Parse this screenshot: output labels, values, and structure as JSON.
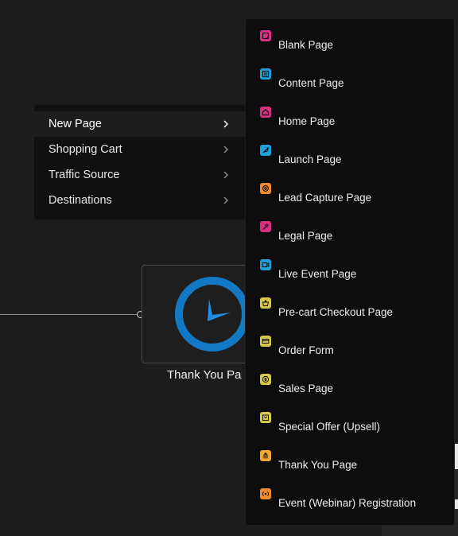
{
  "canvas_node": {
    "label": "Thank You Pa"
  },
  "context_menu": {
    "items": [
      {
        "label": "New Page",
        "active": true
      },
      {
        "label": "Shopping Cart",
        "active": false
      },
      {
        "label": "Traffic Source",
        "active": false
      },
      {
        "label": "Destinations",
        "active": false
      }
    ]
  },
  "submenu": {
    "items": [
      {
        "label": "Blank Page",
        "icon": "sticky-note-icon",
        "color": "#e0308a"
      },
      {
        "label": "Content Page",
        "icon": "document-icon",
        "color": "#1ea0d8"
      },
      {
        "label": "Home Page",
        "icon": "home-icon",
        "color": "#d6307a"
      },
      {
        "label": "Launch Page",
        "icon": "rocket-icon",
        "color": "#1ea0d8"
      },
      {
        "label": "Lead Capture Page",
        "icon": "at-sign-icon",
        "color": "#f08a30"
      },
      {
        "label": "Legal Page",
        "icon": "gavel-icon",
        "color": "#d6307a"
      },
      {
        "label": "Live Event Page",
        "icon": "video-icon",
        "color": "#1ea0d8"
      },
      {
        "label": "Pre-cart Checkout Page",
        "icon": "basket-icon",
        "color": "#d8c848"
      },
      {
        "label": "Order Form",
        "icon": "credit-card-icon",
        "color": "#d8c848"
      },
      {
        "label": "Sales Page",
        "icon": "dollar-icon",
        "color": "#d8c848"
      },
      {
        "label": "Special Offer (Upsell)",
        "icon": "offer-icon",
        "color": "#d8c848"
      },
      {
        "label": "Thank You Page",
        "icon": "hands-icon",
        "color": "#f0a830"
      },
      {
        "label": "Event (Webinar) Registration",
        "icon": "broadcast-icon",
        "color": "#f08a30"
      }
    ]
  },
  "colors": {
    "clock_ring": "#1479c4",
    "clock_hand": "#1e90e8"
  }
}
